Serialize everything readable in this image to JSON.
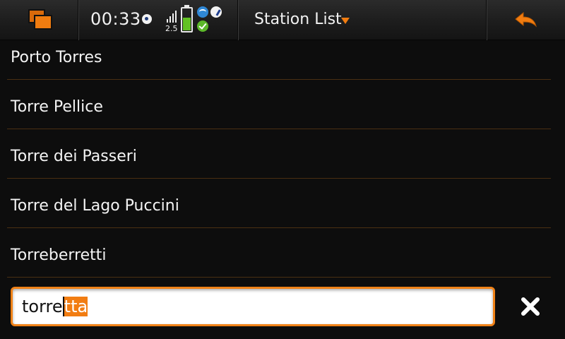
{
  "status_bar": {
    "clock": "00:33",
    "network_type": "2.5",
    "battery_level": 0.55,
    "icons": [
      "task-switcher-icon",
      "alarm-icon",
      "signal-strength-icon",
      "battery-icon",
      "wifi-icon",
      "presence-icon",
      "connected-check-icon"
    ]
  },
  "header": {
    "title": "Station List",
    "menu_icon": "chevron-down-icon",
    "back_icon": "back-arrow-icon"
  },
  "stations": [
    "Porto Torres",
    "Torre Pellice",
    "Torre dei Passeri",
    "Torre del Lago Puccini",
    "Torreberretti"
  ],
  "search": {
    "typed": "torre",
    "completion": "tta",
    "clear_icon": "close-icon"
  },
  "colors": {
    "accent": "#f07c10",
    "background": "#0d0d0d",
    "divider": "#4a2f12",
    "battery": "#62c223"
  }
}
